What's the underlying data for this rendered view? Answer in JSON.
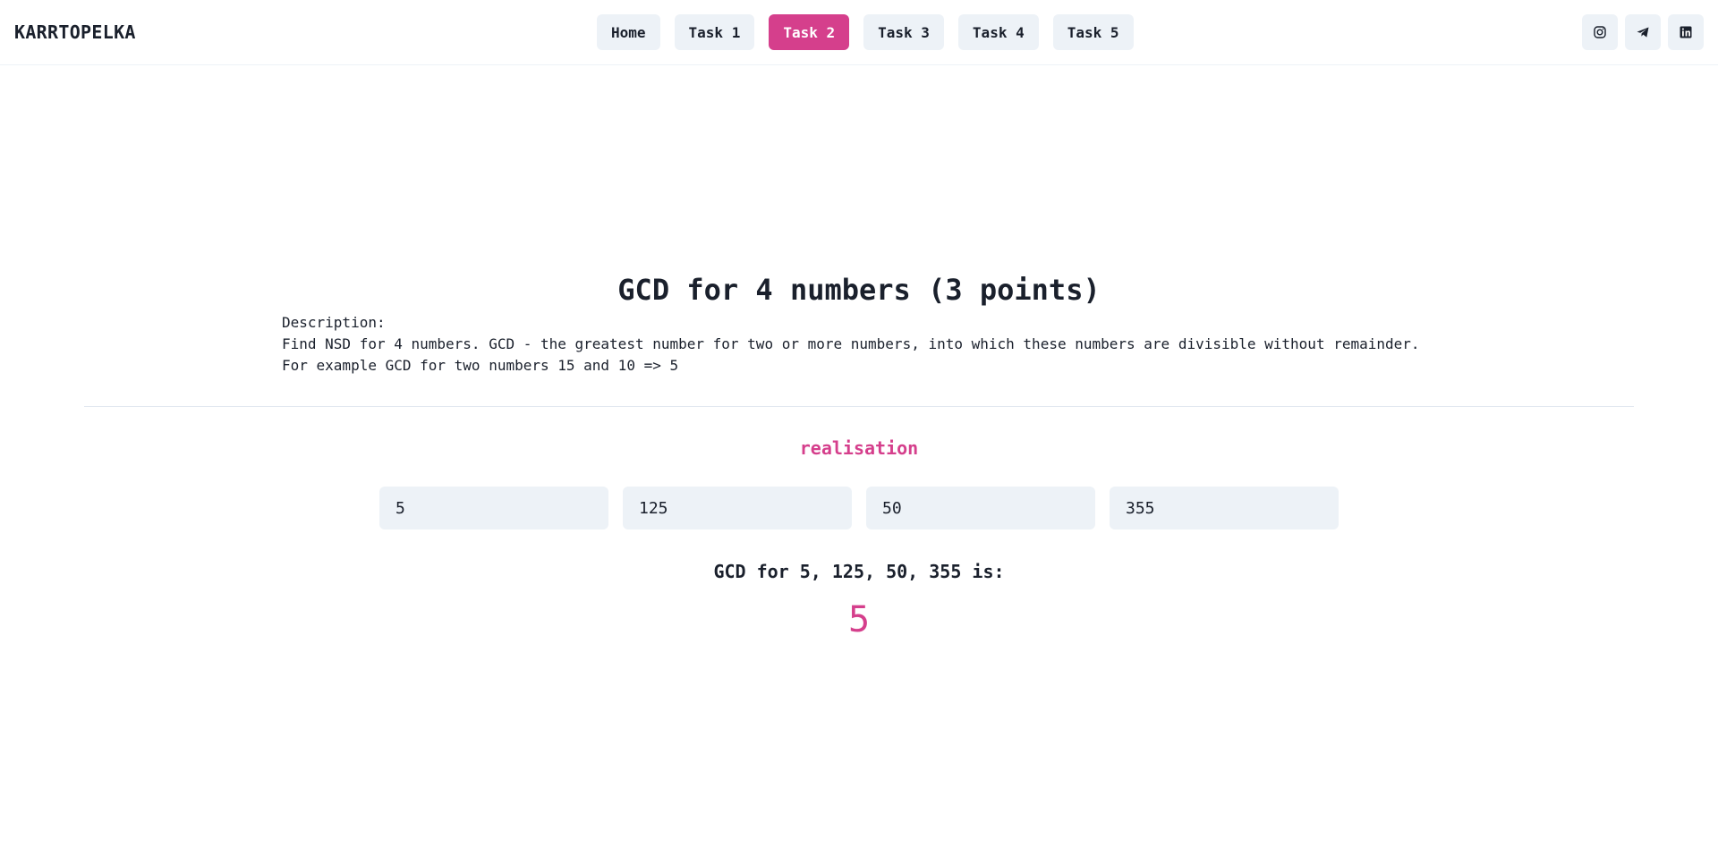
{
  "app": {
    "brand": "KARRTOPELKA"
  },
  "nav": {
    "items": [
      {
        "label": "Home",
        "active": false
      },
      {
        "label": "Task 1",
        "active": false
      },
      {
        "label": "Task 2",
        "active": true
      },
      {
        "label": "Task 3",
        "active": false
      },
      {
        "label": "Task 4",
        "active": false
      },
      {
        "label": "Task 5",
        "active": false
      }
    ]
  },
  "socials": [
    {
      "icon": "instagram-icon"
    },
    {
      "icon": "telegram-icon"
    },
    {
      "icon": "linkedin-icon"
    }
  ],
  "task": {
    "title": "GCD for 4 numbers (3 points)",
    "description_heading": "Description:",
    "description_line1": "Find NSD for 4 numbers. GCD - the greatest number for two or more numbers, into which these numbers are divisible without remainder.",
    "description_line2": "For example GCD for two numbers 15 and 10 => 5"
  },
  "realisation": {
    "heading": "realisation",
    "inputs": [
      {
        "value": "5"
      },
      {
        "value": "125"
      },
      {
        "value": "50"
      },
      {
        "value": "355"
      }
    ],
    "result_label": "GCD for 5, 125, 50, 355 is:",
    "result_value": "5"
  },
  "colors": {
    "accent": "#d53f8c",
    "button_bg": "#edf2f7",
    "text": "#1a202c",
    "divider": "#e2e8f0"
  }
}
